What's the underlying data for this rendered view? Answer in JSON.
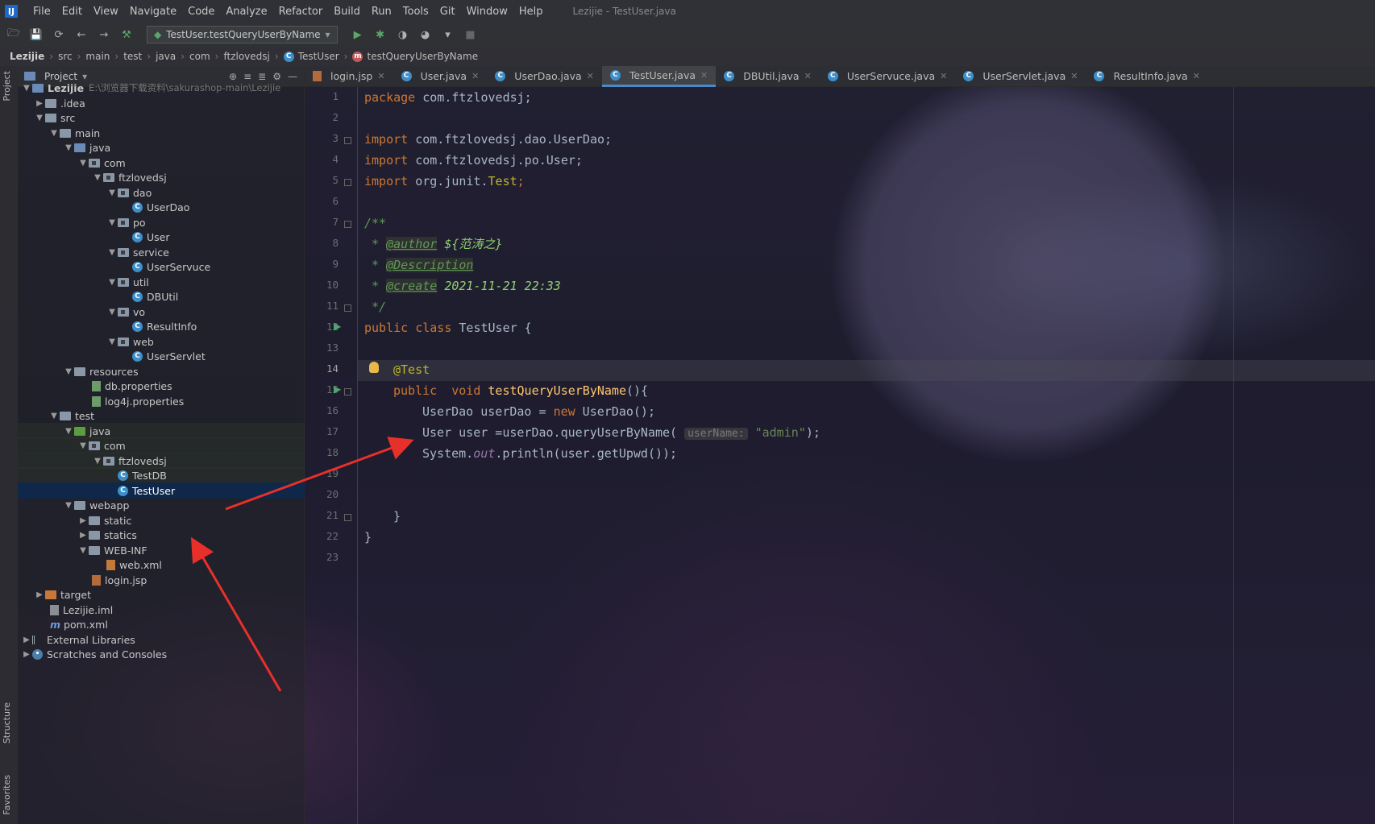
{
  "menubar": {
    "logo": "IJ",
    "items": [
      "File",
      "Edit",
      "View",
      "Navigate",
      "Code",
      "Analyze",
      "Refactor",
      "Build",
      "Run",
      "Tools",
      "Git",
      "Window",
      "Help"
    ],
    "window_title": "Lezijie - TestUser.java"
  },
  "toolbar": {
    "run_config": "TestUser.testQueryUserByName"
  },
  "breadcrumb": [
    "Lezijie",
    "src",
    "main",
    "test",
    "java",
    "com",
    "ftzlovedsj",
    "TestUser",
    "testQueryUserByName"
  ],
  "left_strip": {
    "project_tab": "Project",
    "structure_tab": "Structure",
    "favorites_tab": "Favorites"
  },
  "project_panel": {
    "title": "Project",
    "tree": [
      {
        "label": "Lezijie",
        "hint": "E:\\浏览器下载资料\\sakurashop-main\\Lezijie"
      },
      {
        "label": ".idea"
      },
      {
        "label": "src"
      },
      {
        "label": "main"
      },
      {
        "label": "java"
      },
      {
        "label": "com"
      },
      {
        "label": "ftzlovedsj"
      },
      {
        "label": "dao"
      },
      {
        "label": "UserDao"
      },
      {
        "label": "po"
      },
      {
        "label": "User"
      },
      {
        "label": "service"
      },
      {
        "label": "UserServuce"
      },
      {
        "label": "util"
      },
      {
        "label": "DBUtil"
      },
      {
        "label": "vo"
      },
      {
        "label": "ResultInfo"
      },
      {
        "label": "web"
      },
      {
        "label": "UserServlet"
      },
      {
        "label": "resources"
      },
      {
        "label": "db.properties"
      },
      {
        "label": "log4j.properties"
      },
      {
        "label": "test"
      },
      {
        "label": "java"
      },
      {
        "label": "com"
      },
      {
        "label": "ftzlovedsj"
      },
      {
        "label": "TestDB"
      },
      {
        "label": "TestUser"
      },
      {
        "label": "webapp"
      },
      {
        "label": "static"
      },
      {
        "label": "statics"
      },
      {
        "label": "WEB-INF"
      },
      {
        "label": "web.xml"
      },
      {
        "label": "login.jsp"
      },
      {
        "label": "target"
      },
      {
        "label": "Lezijie.iml"
      },
      {
        "label": "pom.xml"
      },
      {
        "label": "External Libraries"
      },
      {
        "label": "Scratches and Consoles"
      }
    ]
  },
  "editor_tabs": [
    {
      "label": "login.jsp"
    },
    {
      "label": "User.java"
    },
    {
      "label": "UserDao.java"
    },
    {
      "label": "TestUser.java",
      "active": true
    },
    {
      "label": "DBUtil.java"
    },
    {
      "label": "UserServuce.java"
    },
    {
      "label": "UserServlet.java"
    },
    {
      "label": "ResultInfo.java"
    }
  ],
  "line_numbers": [
    "1",
    "2",
    "3",
    "4",
    "5",
    "6",
    "7",
    "8",
    "9",
    "10",
    "11",
    "12",
    "13",
    "14",
    "15",
    "16",
    "17",
    "18",
    "19",
    "20",
    "21",
    "22",
    "23"
  ],
  "code": {
    "l1_kw": "package",
    "l1_rest": " com.ftzlovedsj;",
    "l3_kw": "import",
    "l3_rest": " com.ftzlovedsj.dao.UserDao;",
    "l4_kw": "import",
    "l4_rest": " com.ftzlovedsj.po.User;",
    "l5_kw": "import",
    "l5_rest": " org.junit.",
    "l5_cls": "Test",
    "l5_end": ";",
    "l7": "/**",
    "l8_star": " * ",
    "l8_tag": "@author",
    "l8_text": " ${范涛之}",
    "l9_star": " * ",
    "l9_tag": "@Description",
    "l10_star": " * ",
    "l10_tag": "@create",
    "l10_text": " 2021-11-21 22:33",
    "l11": " */",
    "l12_kw": "public class",
    "l12_rest": " TestUser {",
    "l14_ann": "@Test",
    "l15_kw": "public  void ",
    "l15_fn": "testQueryUserByName",
    "l15_rest": "(){",
    "l16_a": "UserDao userDao = ",
    "l16_kw": "new",
    "l16_b": " UserDao();",
    "l17_a": "User user =userDao.queryUserByName( ",
    "l17_hint": "userName:",
    "l17_str": "\"admin\"",
    "l17_b": ");",
    "l18_a": "System.",
    "l18_field": "out",
    "l18_b": ".println(user.getUpwd());",
    "l21": "}",
    "l22": "}"
  },
  "colors": {
    "keyword": "#cc7832",
    "annotation": "#bbb529",
    "doc": "#629755",
    "string": "#6a8759",
    "function": "#ffc66d",
    "accent": "#4a88c7",
    "annotation_arrow": "#e8302a"
  }
}
